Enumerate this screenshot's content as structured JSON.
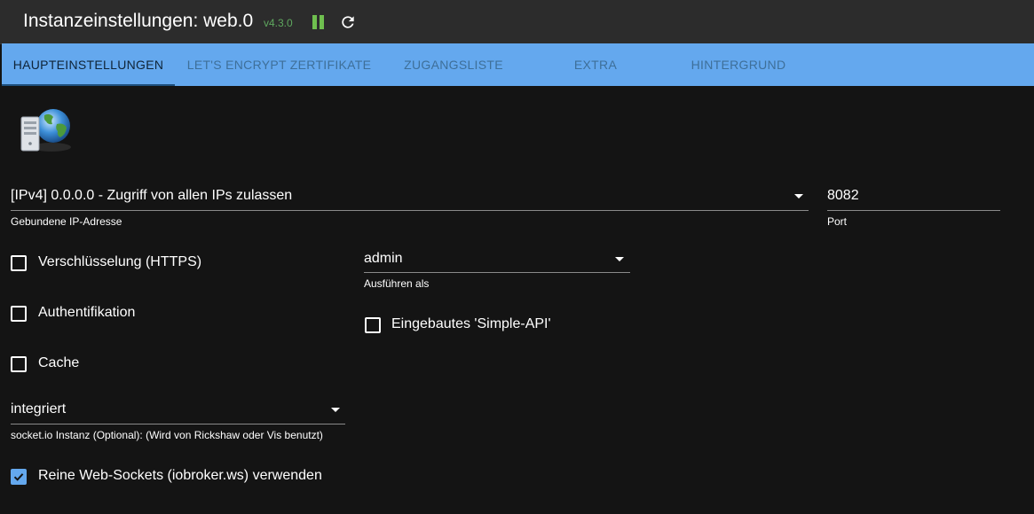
{
  "header": {
    "title": "Instanzeinstellungen: web.0",
    "version": "v4.3.0"
  },
  "tabs": [
    {
      "label": "HAUPTEINSTELLUNGEN",
      "active": true
    },
    {
      "label": "LET'S ENCRYPT ZERTIFIKATE",
      "active": false
    },
    {
      "label": "ZUGANGSLISTE",
      "active": false
    },
    {
      "label": "EXTRA",
      "active": false
    },
    {
      "label": "HINTERGRUND",
      "active": false
    }
  ],
  "form": {
    "ip": {
      "value": "[IPv4] 0.0.0.0 - Zugriff von allen IPs zulassen",
      "helper": "Gebundene IP-Adresse"
    },
    "port": {
      "value": "8082",
      "helper": "Port"
    },
    "https": {
      "label": "Verschlüsselung (HTTPS)",
      "checked": false
    },
    "auth": {
      "label": "Authentifikation",
      "checked": false
    },
    "cache": {
      "label": "Cache",
      "checked": false
    },
    "run_as": {
      "value": "admin",
      "helper": "Ausführen als"
    },
    "simple_api": {
      "label": "Eingebautes 'Simple-API'",
      "checked": false
    },
    "socketio": {
      "value": "integriert",
      "helper": "socket.io Instanz (Optional): (Wird von Rickshaw oder Vis benutzt)"
    },
    "pure_ws": {
      "label": "Reine Web-Sockets (iobroker.ws) verwenden",
      "checked": true
    }
  },
  "colors": {
    "tab_bar": "#64a8ee",
    "version": "#5fa85f",
    "pause": "#6fbf4f",
    "background": "#141414"
  },
  "icons": [
    "pause-icon",
    "refresh-icon",
    "server-globe-icon",
    "chevron-down-icon",
    "checkbox-icon",
    "check-icon"
  ]
}
